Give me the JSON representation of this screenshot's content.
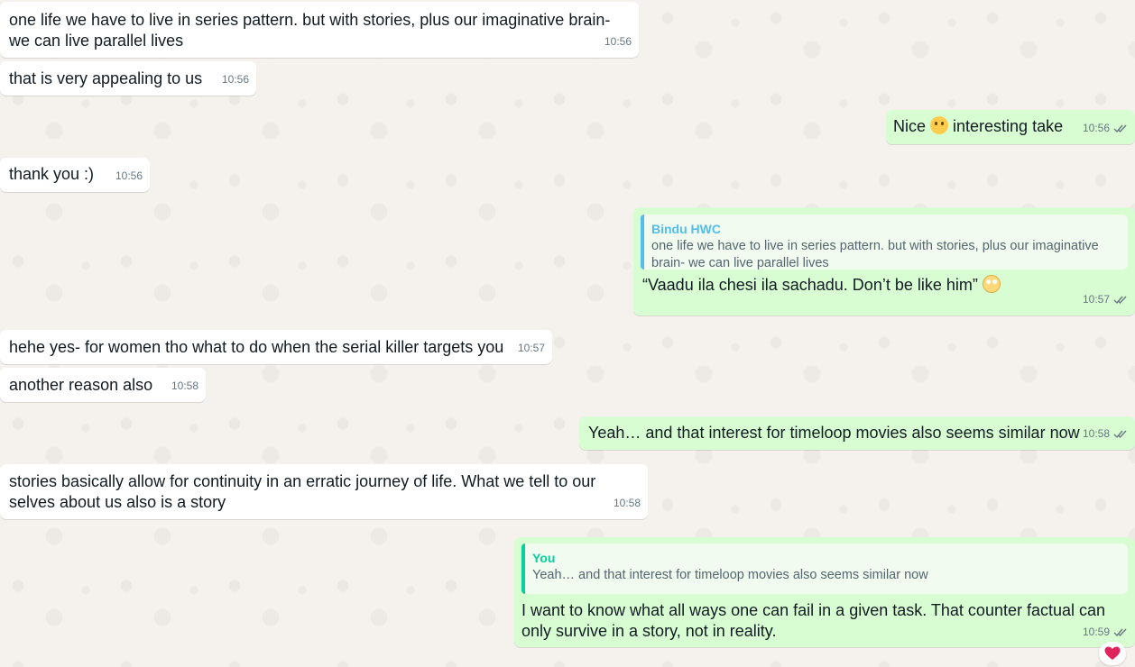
{
  "messages": [
    {
      "text": "one life we have to live in series pattern. but with stories, plus our imaginative brain- we can live parallel lives",
      "time": "10:56"
    },
    {
      "text": "that is very appealing to us",
      "time": "10:56"
    },
    {
      "text_before": "Nice ",
      "emoji": "smiling-face",
      "text_after": " interesting take",
      "time": "10:56"
    },
    {
      "text": "thank you :)",
      "time": "10:56"
    },
    {
      "quote_author": "Bindu HWC",
      "quote_text": "one life we have to live in series pattern. but with stories, plus our imaginative brain- we can live parallel lives",
      "text": "“Vaadu ila chesi ila sachadu. Don’t be like him” ",
      "emoji": "face-with-rolling-eyes",
      "time": "10:57"
    },
    {
      "text": "hehe yes- for women tho what to do when the serial killer targets you",
      "time": "10:57"
    },
    {
      "text": "another reason also",
      "time": "10:58"
    },
    {
      "text": "Yeah… and that interest for timeloop movies also seems similar now",
      "time": "10:58"
    },
    {
      "text": "stories basically allow for continuity in an erratic journey of life. What we tell to our selves about us also is a story",
      "time": "10:58"
    },
    {
      "quote_author": "You",
      "quote_text": "Yeah… and that interest for timeloop movies also seems similar now",
      "text": "I want to know what all ways one can fail in a given task. That counter factual can only survive in a story, not in reality.",
      "time": "10:59",
      "reaction": "red-heart"
    }
  ],
  "colors": {
    "incoming": "#ffffff",
    "outgoing": "#d9fdd3",
    "read_ticks": "#667781",
    "quote_bar_other": "#53bdeb",
    "quote_bar_self": "#06cf9c",
    "reaction_heart": "#e0245e"
  }
}
